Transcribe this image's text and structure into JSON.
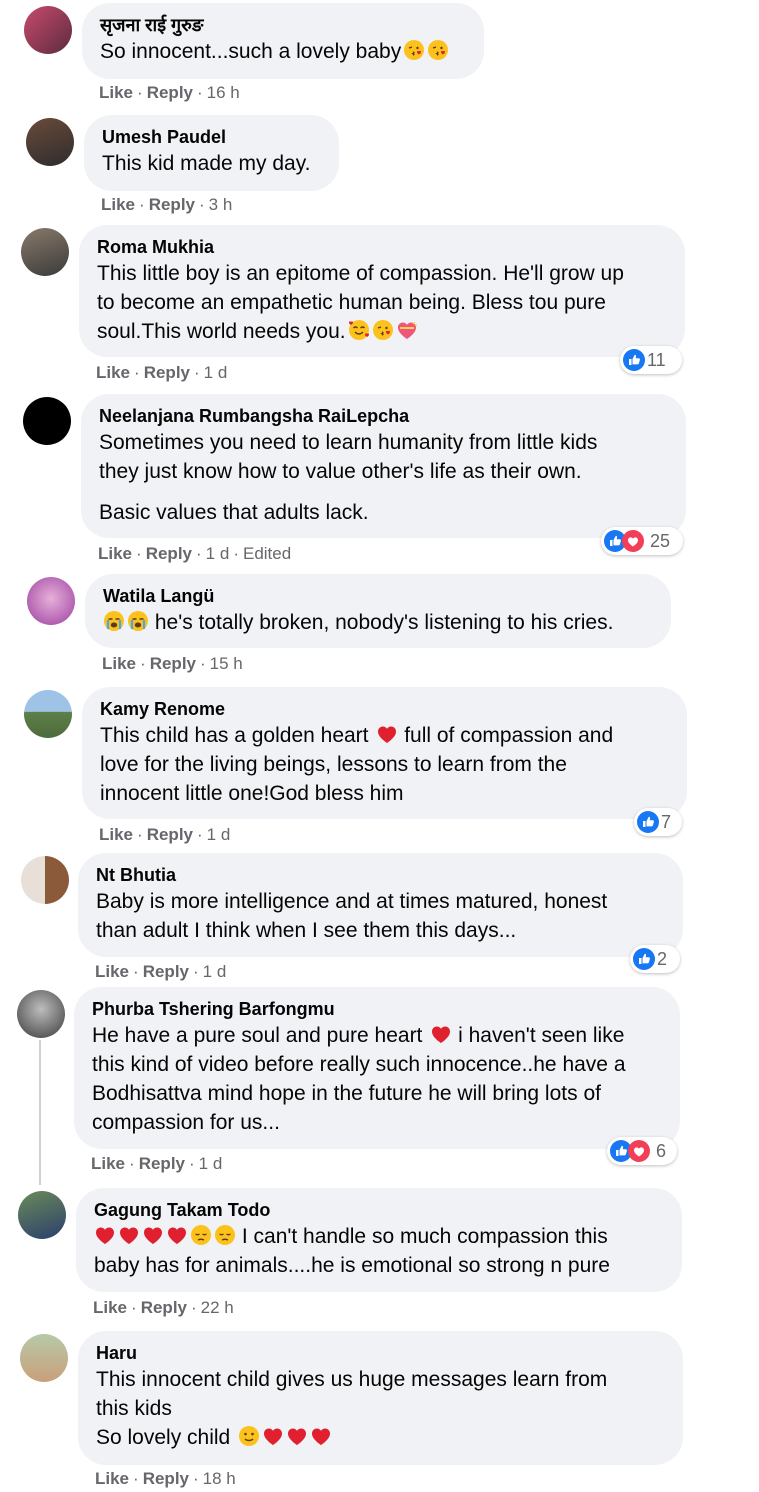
{
  "comments": [
    {
      "name": "सृजना राई गुरुङ",
      "lines": [
        "So innocent...such a lovely baby"
      ],
      "like": "Like",
      "reply": "Reply",
      "time": "16 h"
    },
    {
      "name": "Umesh Paudel",
      "lines": [
        "This kid made my day."
      ],
      "like": "Like",
      "reply": "Reply",
      "time": "3 h"
    },
    {
      "name": "Roma Mukhia",
      "lines": [
        "This little boy is an epitome of compassion. He'll grow up",
        "to become an empathetic human being. Bless tou pure",
        "soul.This world needs you."
      ],
      "like": "Like",
      "reply": "Reply",
      "time": "1 d",
      "reactions": "11"
    },
    {
      "name": "Neelanjana Rumbangsha RaiLepcha",
      "lines": [
        "Sometimes you need to learn humanity from little kids",
        "they just know how to value other's life as their own.",
        "Basic values that adults lack."
      ],
      "like": "Like",
      "reply": "Reply",
      "time": "1 d",
      "edited": "Edited",
      "reactions": "25"
    },
    {
      "name": "Watila Langü",
      "lines": [
        "he's totally broken, nobody's listening to his cries."
      ],
      "like": "Like",
      "reply": "Reply",
      "time": "15 h"
    },
    {
      "name": "Kamy Renome",
      "lines": [
        "This child has a golden heart",
        "full of compassion and",
        "love for the living beings, lessons to learn from the",
        "innocent little one!God bless him"
      ],
      "like": "Like",
      "reply": "Reply",
      "time": "1 d",
      "reactions": "7"
    },
    {
      "name": "Nt Bhutia",
      "lines": [
        "Baby is more intelligence and at times matured, honest",
        "than adult I think when I see them this days..."
      ],
      "like": "Like",
      "reply": "Reply",
      "time": "1 d",
      "reactions": "2"
    },
    {
      "name": "Phurba Tshering Barfongmu",
      "lines": [
        "He have a pure soul and pure heart",
        "i haven't seen like",
        "this kind of video before really such innocence..he have a",
        "Bodhisattva mind hope in the future he will bring lots of",
        "compassion for us..."
      ],
      "like": "Like",
      "reply": "Reply",
      "time": "1 d",
      "reactions": "6"
    },
    {
      "name": "Gagung Takam Todo",
      "lines": [
        "I can't handle so much compassion this",
        "baby has for animals....he is emotional so strong n pure"
      ],
      "like": "Like",
      "reply": "Reply",
      "time": "22 h"
    },
    {
      "name": "Haru",
      "lines": [
        "This innocent child gives us huge messages learn from",
        "this kids",
        "So lovely child"
      ],
      "like": "Like",
      "reply": "Reply",
      "time": "18 h"
    }
  ],
  "icons": {
    "like": "like-reaction-icon",
    "love": "love-reaction-icon",
    "kiss": "kissing-face-emoji",
    "heart": "red-heart-emoji",
    "cry": "crying-face-emoji",
    "pensive": "pensive-face-emoji",
    "smiling": "smiling-face-emoji",
    "hearts": "smiling-face-with-hearts-emoji",
    "sparkle-heart": "heart-with-ribbon-emoji"
  },
  "colors": {
    "bubble": "#f0f2f5",
    "meta": "#65676b",
    "like_blue": "#1877f2",
    "love_red": "#f33e58"
  }
}
